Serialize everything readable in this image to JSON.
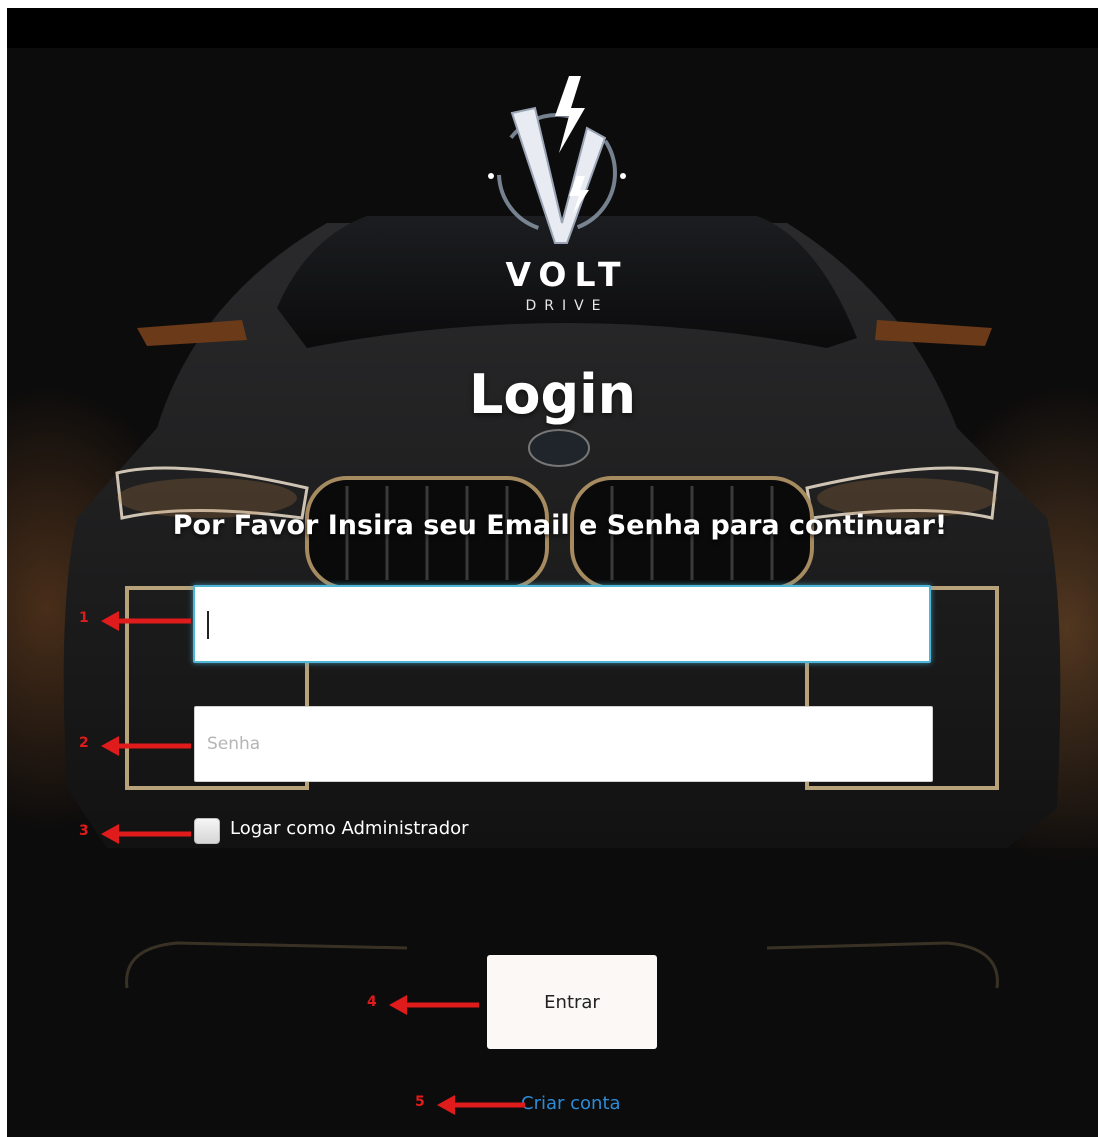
{
  "brand": {
    "name": "VOLT",
    "tagline": "DRIVE"
  },
  "login": {
    "title": "Login",
    "subtitle": "Por Favor Insira seu Email e Senha para continuar!",
    "email_value": "",
    "password_placeholder": "Senha",
    "admin_checkbox_label": "Logar como Administrador",
    "admin_checked": false,
    "submit_label": "Entrar",
    "create_account_label": "Criar conta"
  },
  "annotations": {
    "a1": "1",
    "a2": "2",
    "a3": "3",
    "a4": "4",
    "a5": "5"
  },
  "colors": {
    "background": "#0d0c0c",
    "focus_border": "#4fb6d8",
    "link": "#2d8bd6",
    "annotation": "#e01b1b"
  }
}
